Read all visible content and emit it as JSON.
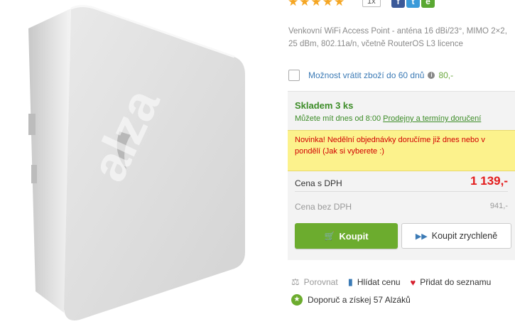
{
  "product": {
    "image_watermark": "alza",
    "rating_stars": 5,
    "rating_count_badge": "1x",
    "social": [
      "f",
      "t",
      "e"
    ],
    "description": "Venkovní WiFi Access Point - anténa 16 dBi/23°, MIMO 2×2, 25 dBm, 802.11a/n, včetně RouterOS L3 licence"
  },
  "return_option": {
    "label": "Možnost vrátit zboží do 60 dnů",
    "price": "80,-"
  },
  "stock": {
    "title": "Skladem 3 ks",
    "sub_prefix": "Můžete mít dnes od 8:00",
    "sub_link": "Prodejny a termíny doručení"
  },
  "notice": "Novinka! Nedělní objednávky doručíme již dnes nebo v pondělí (Jak si vyberete :)",
  "pricing": {
    "with_vat_label": "Cena s DPH",
    "with_vat_value": "1 139,-",
    "without_vat_label": "Cena bez DPH",
    "without_vat_value": "941,-"
  },
  "buttons": {
    "buy": "Koupit",
    "buy_fast": "Koupit zrychleně"
  },
  "actions": {
    "compare": "Porovnat",
    "watch_price": "Hlídat cenu",
    "add_to_list": "Přidat do seznamu",
    "recommend": "Doporuč a získej 57 Alzáků"
  },
  "colors": {
    "accent_green": "#6cac2e",
    "price_red": "#e31c1c",
    "stock_green": "#3c8c27",
    "notice_yellow": "#fcf28c",
    "link_blue": "#3b7ab5"
  }
}
